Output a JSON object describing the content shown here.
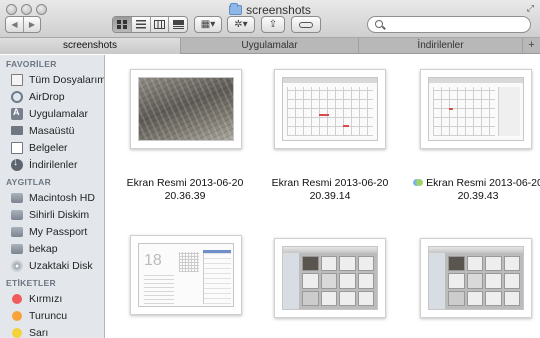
{
  "window": {
    "title": "screenshots",
    "folder_icon": "folder-icon"
  },
  "toolbar": {
    "back": "◀",
    "forward": "▶",
    "view_modes": [
      "icon-view",
      "list-view",
      "column-view",
      "coverflow-view"
    ],
    "arrange_glyph": "▦▾",
    "action_glyph": "✲▾",
    "share_glyph": "⇪",
    "search_placeholder": "",
    "search_value": ""
  },
  "tabs": [
    {
      "label": "screenshots",
      "active": true
    },
    {
      "label": "Uygulamalar",
      "active": false
    },
    {
      "label": "İndirilenler",
      "active": false
    }
  ],
  "tab_add": "+",
  "sidebar": {
    "favorites_header": "FAVORİLER",
    "favorites": [
      {
        "label": "Tüm Dosyalarım",
        "icon": "all-files-icon"
      },
      {
        "label": "AirDrop",
        "icon": "airdrop-icon"
      },
      {
        "label": "Uygulamalar",
        "icon": "applications-icon"
      },
      {
        "label": "Masaüstü",
        "icon": "desktop-icon"
      },
      {
        "label": "Belgeler",
        "icon": "documents-icon"
      },
      {
        "label": "İndirilenler",
        "icon": "downloads-icon"
      }
    ],
    "devices_header": "AYGITLAR",
    "devices": [
      {
        "label": "Macintosh HD",
        "icon": "hard-disk-icon"
      },
      {
        "label": "Sihirli Diskim",
        "icon": "disc-icon"
      },
      {
        "label": "My Passport",
        "icon": "external-disk-icon"
      },
      {
        "label": "bekap",
        "icon": "external-disk-icon"
      },
      {
        "label": "Uzaktaki Disk",
        "icon": "remote-disc-icon"
      }
    ],
    "tags_header": "ETİKETLER",
    "tags": [
      {
        "label": "Kırmızı",
        "color": "#f05a5a"
      },
      {
        "label": "Turuncu",
        "color": "#f7a23b"
      },
      {
        "label": "Sarı",
        "color": "#f4d23a"
      }
    ]
  },
  "files": [
    {
      "line1": "Ekran Resmi 2013-06-20",
      "line2": "20.36.39",
      "tagged": false
    },
    {
      "line1": "Ekran Resmi 2013-06-20",
      "line2": "20.39.14",
      "tagged": false
    },
    {
      "line1": "Ekran Resmi 2013-06-20",
      "line2": "20.39.43",
      "tagged": true
    },
    {
      "line1": "",
      "line2": "",
      "tagged": false
    },
    {
      "line1": "",
      "line2": "",
      "tagged": false
    },
    {
      "line1": "",
      "line2": "",
      "tagged": false
    }
  ],
  "thumb_day_number": "18"
}
